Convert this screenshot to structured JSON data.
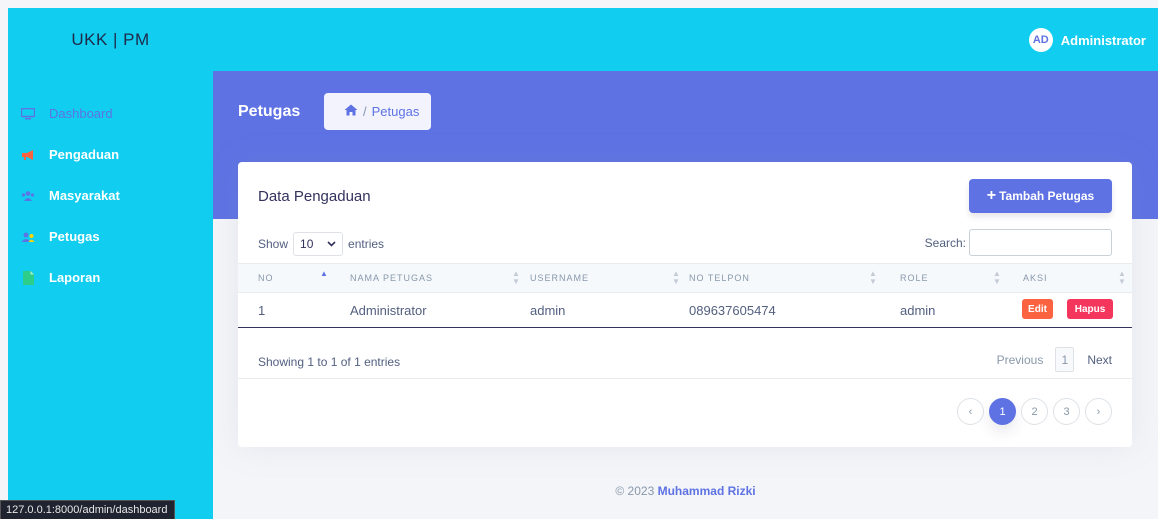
{
  "sidebar": {
    "brand": "UKK | PM",
    "items": [
      {
        "label": "Dashboard",
        "icon": "monitor-icon"
      },
      {
        "label": "Pengaduan",
        "icon": "megaphone-icon"
      },
      {
        "label": "Masyarakat",
        "icon": "users-icon"
      },
      {
        "label": "Petugas",
        "icon": "user-group-icon"
      },
      {
        "label": "Laporan",
        "icon": "file-icon"
      }
    ]
  },
  "status_url": "127.0.0.1:8000/admin/dashboard",
  "topbar": {
    "avatar_initials": "AD",
    "user_name": "Administrator"
  },
  "header": {
    "title": "Petugas",
    "breadcrumb": [
      "Petugas"
    ],
    "breadcrumb_separator": "/"
  },
  "card": {
    "title": "Data Pengaduan",
    "add_button": "Tambah Petugas",
    "length": {
      "show": "Show",
      "value": "10",
      "entries": "entries"
    },
    "search_label": "Search:",
    "columns": [
      "NO",
      "NAMA PETUGAS",
      "USERNAME",
      "NO TELPON",
      "ROLE",
      "AKSI"
    ],
    "rows": [
      {
        "no": "1",
        "nama": "Administrator",
        "username": "admin",
        "telpon": "089637605474",
        "role": "admin",
        "edit": "Edit",
        "hapus": "Hapus"
      }
    ],
    "info": "Showing 1 to 1 of 1 entries",
    "pager": {
      "previous": "Previous",
      "current": "1",
      "next": "Next"
    },
    "pagination": [
      "‹",
      "1",
      "2",
      "3",
      "›"
    ]
  },
  "footer": {
    "copyright": "© 2023",
    "author": "Muhammad Rizki"
  },
  "colors": {
    "accent": "#5e72e4",
    "sidebar": "#11cdef",
    "edit": "#fb6340",
    "delete": "#f5365c"
  }
}
